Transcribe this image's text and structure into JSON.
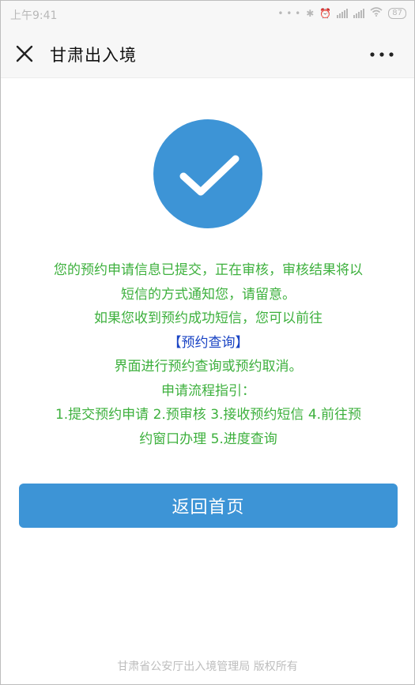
{
  "status_bar": {
    "time": "上午9:41",
    "battery": "87"
  },
  "nav": {
    "title": "甘肃出入境"
  },
  "message": {
    "line1": "您的预约申请信息已提交，正在审核，审核结果将以",
    "line2": "短信的方式通知您，请留意。",
    "line3": "如果您收到预约成功短信，您可以前往",
    "link": "【预约查询】",
    "line4": "界面进行预约查询或预约取消。",
    "line5": "申请流程指引：",
    "line6": "1.提交预约申请 2.预审核 3.接收预约短信 4.前往预",
    "line7": "约窗口办理 5.进度查询"
  },
  "button": {
    "label": "返回首页"
  },
  "footer": {
    "text": "甘肃省公安厅出入境管理局 版权所有"
  },
  "colors": {
    "accent": "#3d94d6",
    "success_text": "#3db03d",
    "link": "#1a44c4"
  },
  "icons": [
    "close-icon",
    "more-icon",
    "checkmark-icon",
    "bluetooth-icon",
    "alarm-icon",
    "signal-icon",
    "wifi-icon",
    "battery-icon"
  ]
}
